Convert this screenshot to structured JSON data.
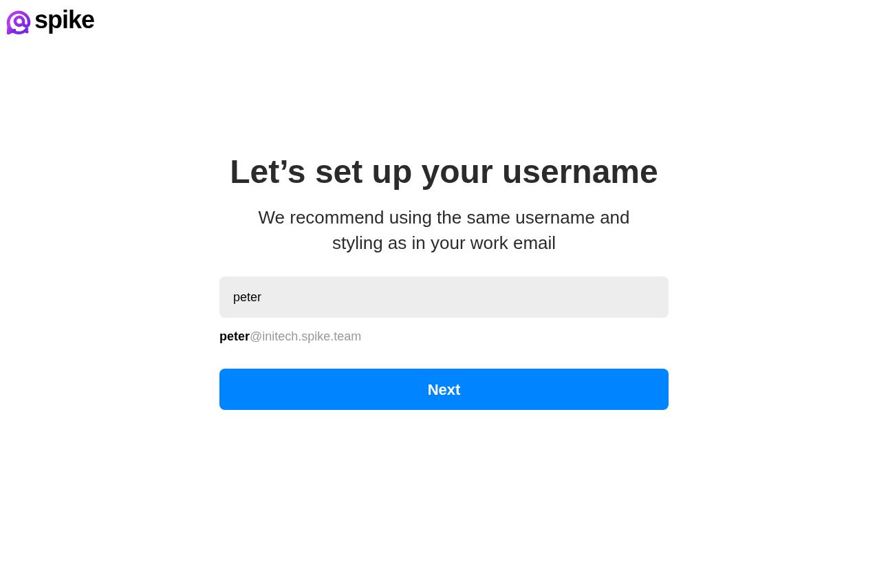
{
  "logo": {
    "text": "spike"
  },
  "heading": "Let’s set up your username",
  "subtitle": "We recommend using the same username and styling as in your work email",
  "username_field": {
    "value": "peter"
  },
  "address_preview": "**peter**@initech.spike.team",
  "next_button": {
    "label": "Next"
  }
}
